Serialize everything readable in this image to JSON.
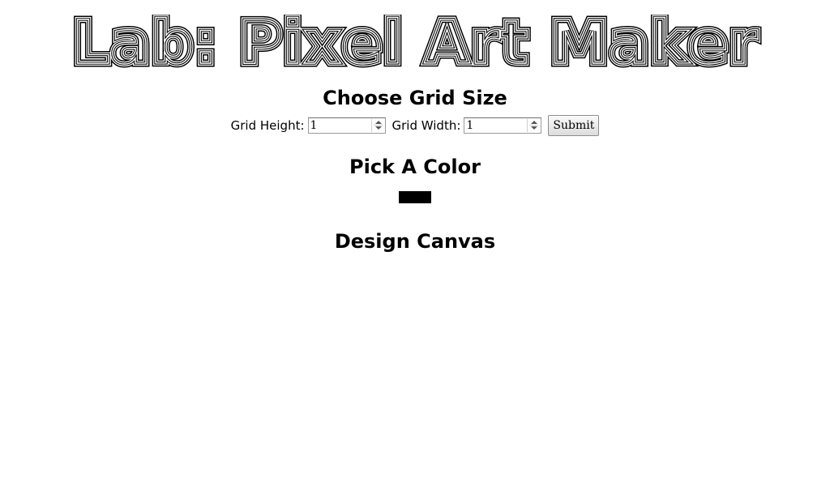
{
  "page": {
    "title": "Lab: Pixel Art Maker"
  },
  "grid_size": {
    "heading": "Choose Grid Size",
    "height_label": "Grid Height:",
    "height_value": "1",
    "width_label": "Grid Width:",
    "width_value": "1",
    "submit_label": "Submit"
  },
  "color": {
    "heading": "Pick A Color",
    "value": "#000000"
  },
  "canvas": {
    "heading": "Design Canvas"
  }
}
